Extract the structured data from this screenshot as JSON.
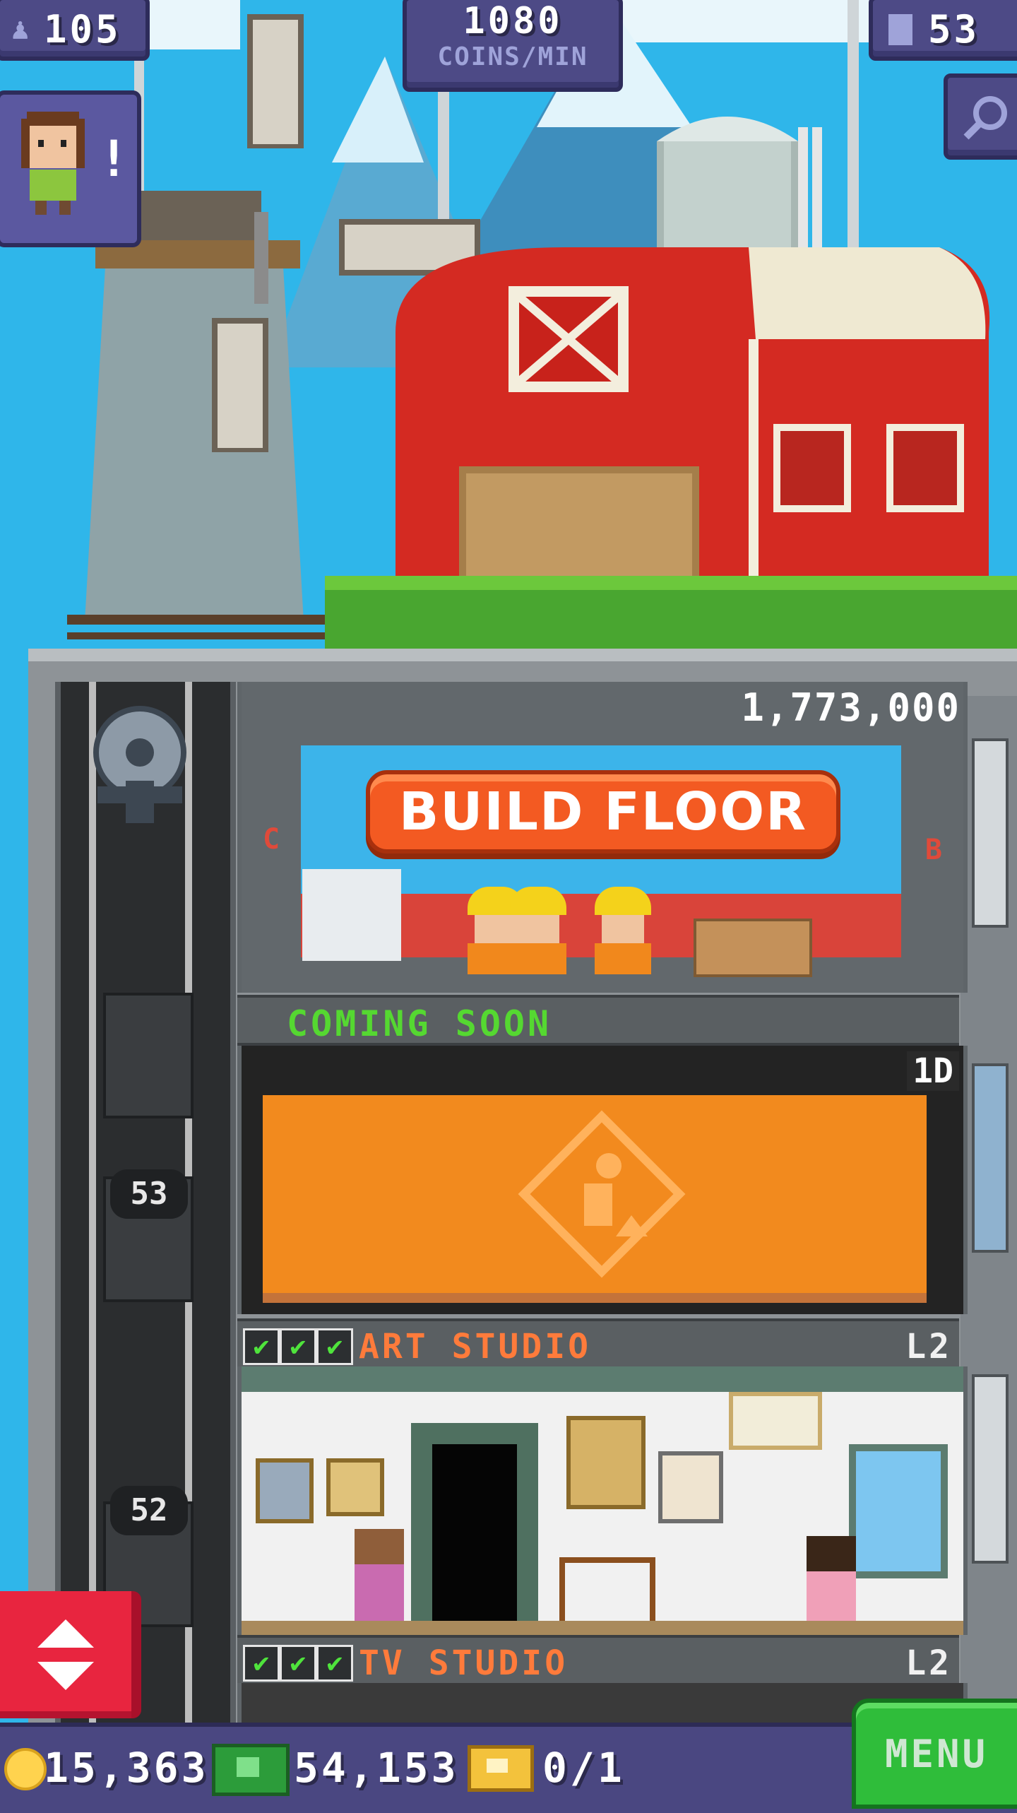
{
  "hud": {
    "population": "105",
    "coins_rate_value": "1080",
    "coins_rate_unit": "COINS/MIN",
    "floors": "53"
  },
  "build_panel": {
    "cost": "1,773,000",
    "button_label": "BUILD FLOOR",
    "left_marker": "C",
    "right_marker": "B",
    "status": "COMING SOON"
  },
  "construction": {
    "timer": "1D"
  },
  "floors": [
    {
      "name": "ART STUDIO",
      "level": "L2",
      "number": "53",
      "checks": 3
    },
    {
      "name": "TV STUDIO",
      "level": "L2",
      "number": "52",
      "checks": 3
    }
  ],
  "bottom_bar": {
    "coins": "15,363",
    "bux": "54,153",
    "tickets": "0/1",
    "menu_label": "MENU"
  },
  "colors": {
    "hud_panel": "#4d4a86",
    "build_button": "#f35a22",
    "floor_label": "#ff7b3b",
    "coming_soon": "#55d831",
    "menu_button": "#2fbd3a",
    "elevator_button": "#e8253f"
  },
  "icons": {
    "population": "person-icon",
    "floors": "building-icon",
    "search": "magnifier-icon",
    "elevator": "up-down-arrows-icon",
    "coins": "coin-icon",
    "bux": "cash-icon",
    "tickets": "ticket-icon",
    "check": "checkmark-icon"
  }
}
